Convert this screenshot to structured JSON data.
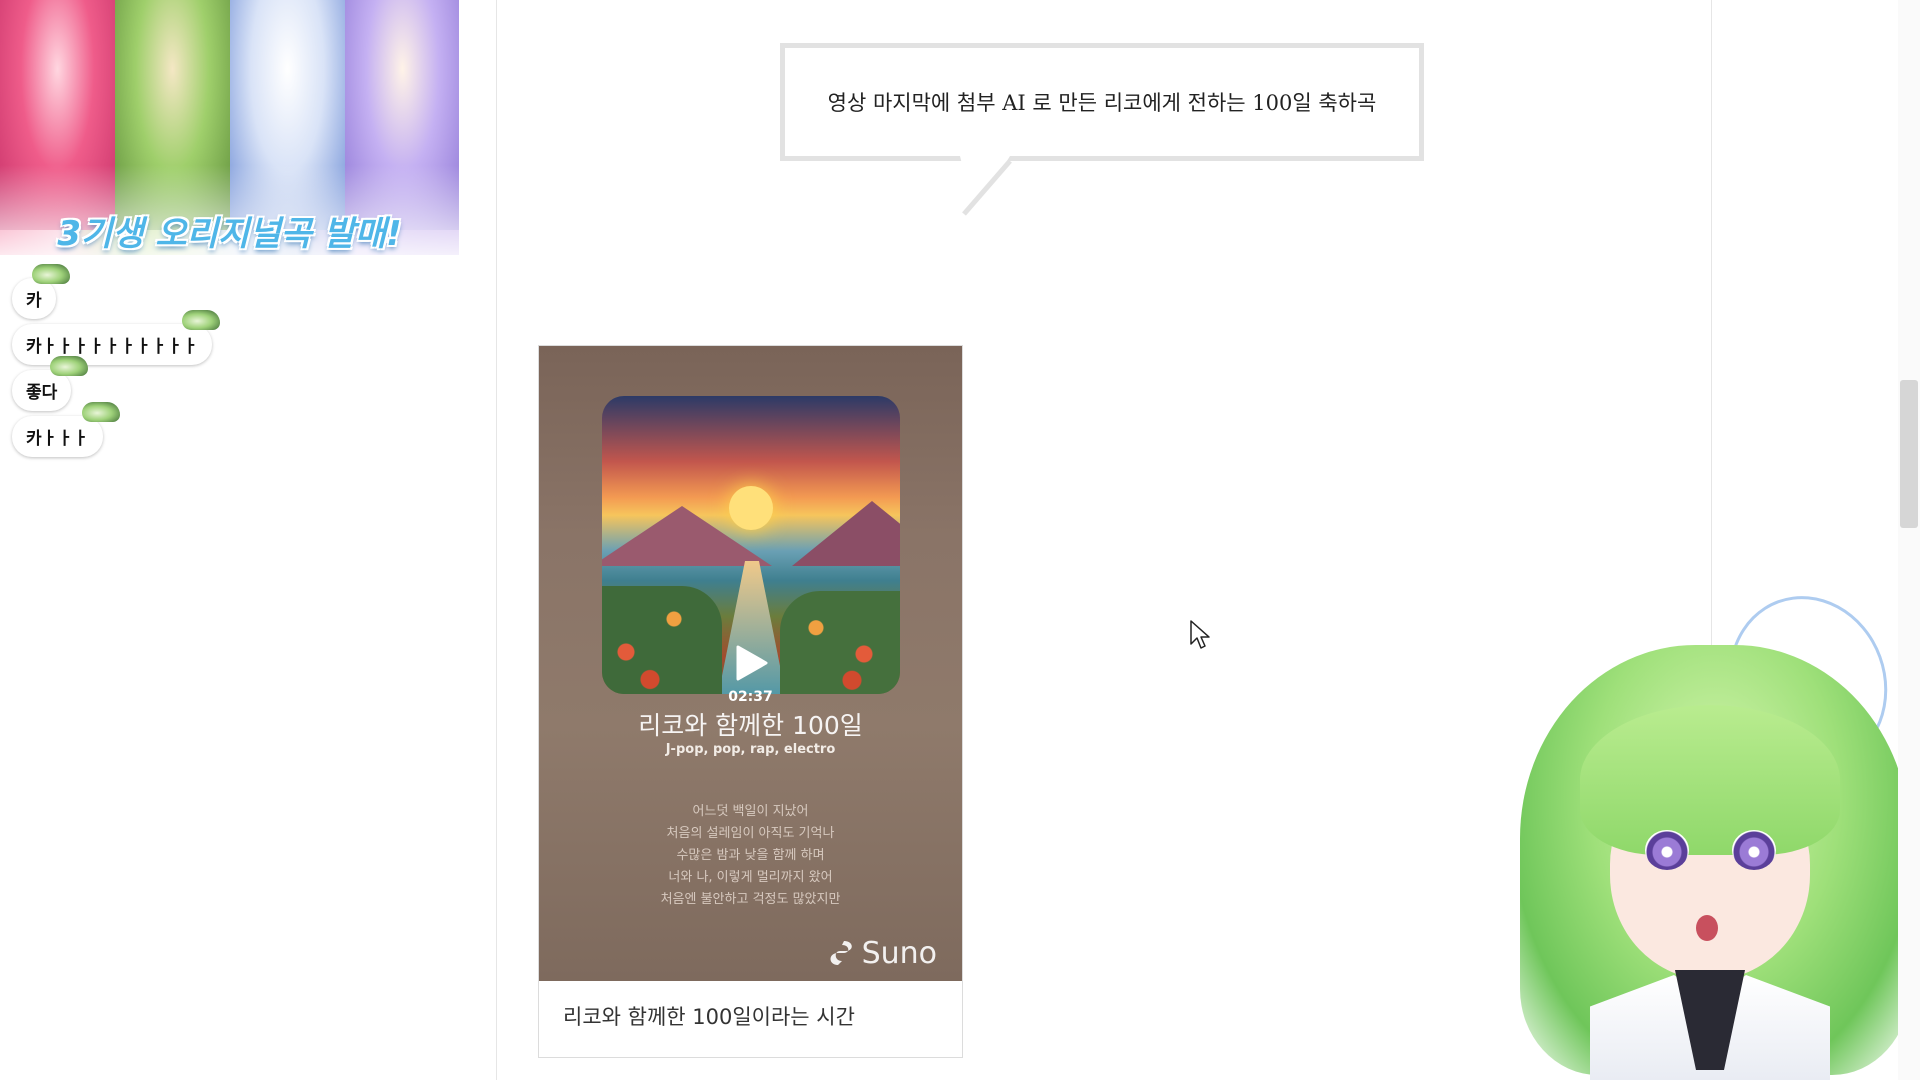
{
  "banner": {
    "text": "3기생 오리지널곡 발매!"
  },
  "chat": {
    "messages": [
      {
        "text": "카"
      },
      {
        "text": "카ㅏㅏㅏㅏㅏㅏㅏㅏㅏㅏ"
      },
      {
        "text": "좋다"
      },
      {
        "text": "카ㅏㅏㅏ"
      }
    ]
  },
  "post": {
    "speech_text": "영상 마지막에 첨부 AI 로 만든 리코에게 전하는 100일 축하곡"
  },
  "video_card": {
    "duration": "02:37",
    "song_title": "리코와 함께한 100일",
    "genre": "J-pop, pop, rap, electro",
    "lyrics": [
      "어느덧 백일이 지났어",
      "처음의 설레임이 아직도 기억나",
      "수많은 밤과 낮을 함께 하며",
      "너와 나, 이렇게 멀리까지 왔어",
      "처음엔 불안하고 걱정도 많았지만"
    ],
    "brand": "Suno",
    "caption": "리코와 함께한 100일이라는 시간"
  },
  "colors": {
    "accent": "#4fb6e8",
    "border": "#e2e2e2",
    "card_bg": "#8a7467"
  }
}
